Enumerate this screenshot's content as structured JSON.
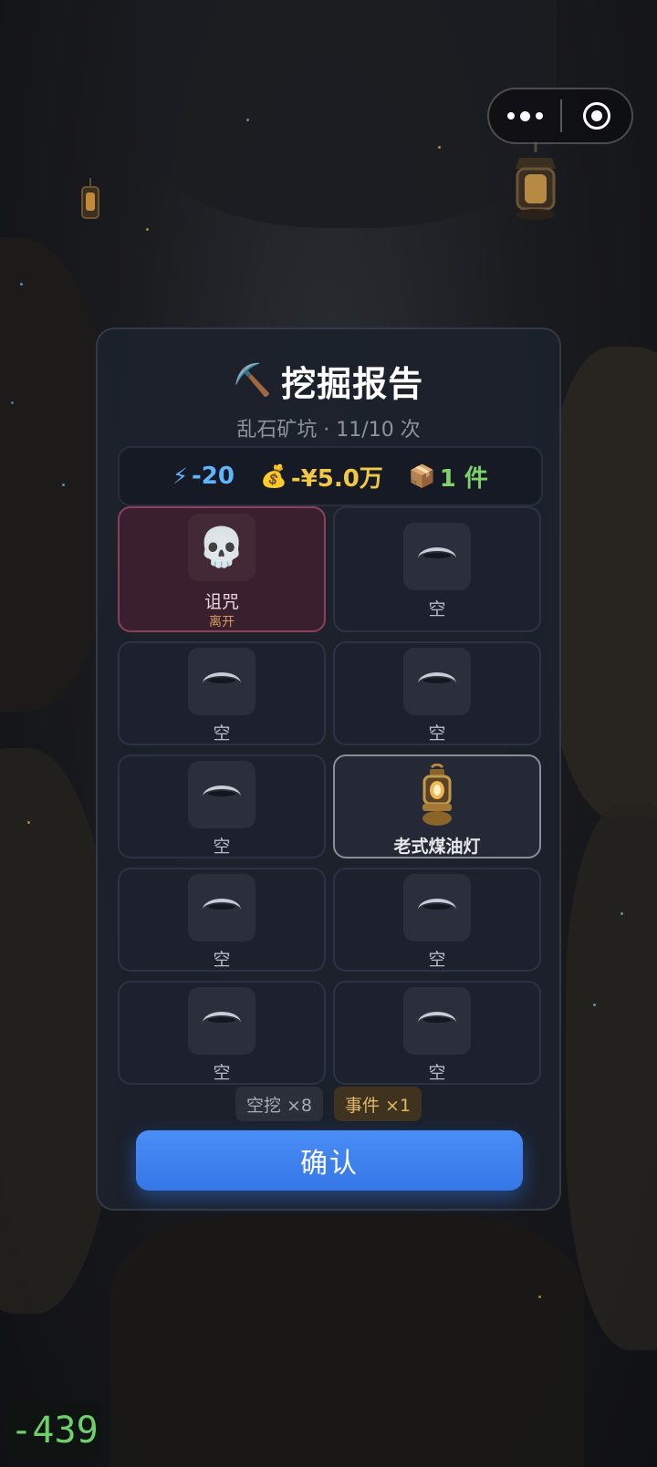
{
  "header": {
    "more_icon": "ellipsis-icon",
    "close_icon": "target-circle-icon"
  },
  "report": {
    "title_icon": "⛏️",
    "title": "挖掘报告",
    "subtitle": "乱石矿坑 · 11/10 次",
    "summary": {
      "energy": {
        "icon": "⚡",
        "value": "-20"
      },
      "money": {
        "icon": "💰",
        "value": "-¥5.0万"
      },
      "items": {
        "icon": "📦",
        "value": "1 件"
      }
    },
    "cells": [
      {
        "type": "curse",
        "icon": "💀",
        "label": "诅咒",
        "sub": "离开"
      },
      {
        "type": "empty",
        "label": "空"
      },
      {
        "type": "empty",
        "label": "空"
      },
      {
        "type": "empty",
        "label": "空"
      },
      {
        "type": "empty",
        "label": "空"
      },
      {
        "type": "found",
        "icon": "🏮",
        "label": "老式煤油灯"
      },
      {
        "type": "empty",
        "label": "空"
      },
      {
        "type": "empty",
        "label": "空"
      },
      {
        "type": "empty",
        "label": "空"
      },
      {
        "type": "empty",
        "label": "空"
      }
    ],
    "tags": {
      "empty_count": "空挖 ×8",
      "event_count": "事件 ×1"
    },
    "confirm_label": "确认"
  },
  "debug_value": "-439",
  "colors": {
    "accent_blue": "#3576e6",
    "energy": "#5fb6ff",
    "money": "#f2c744",
    "items": "#7fd26b"
  }
}
